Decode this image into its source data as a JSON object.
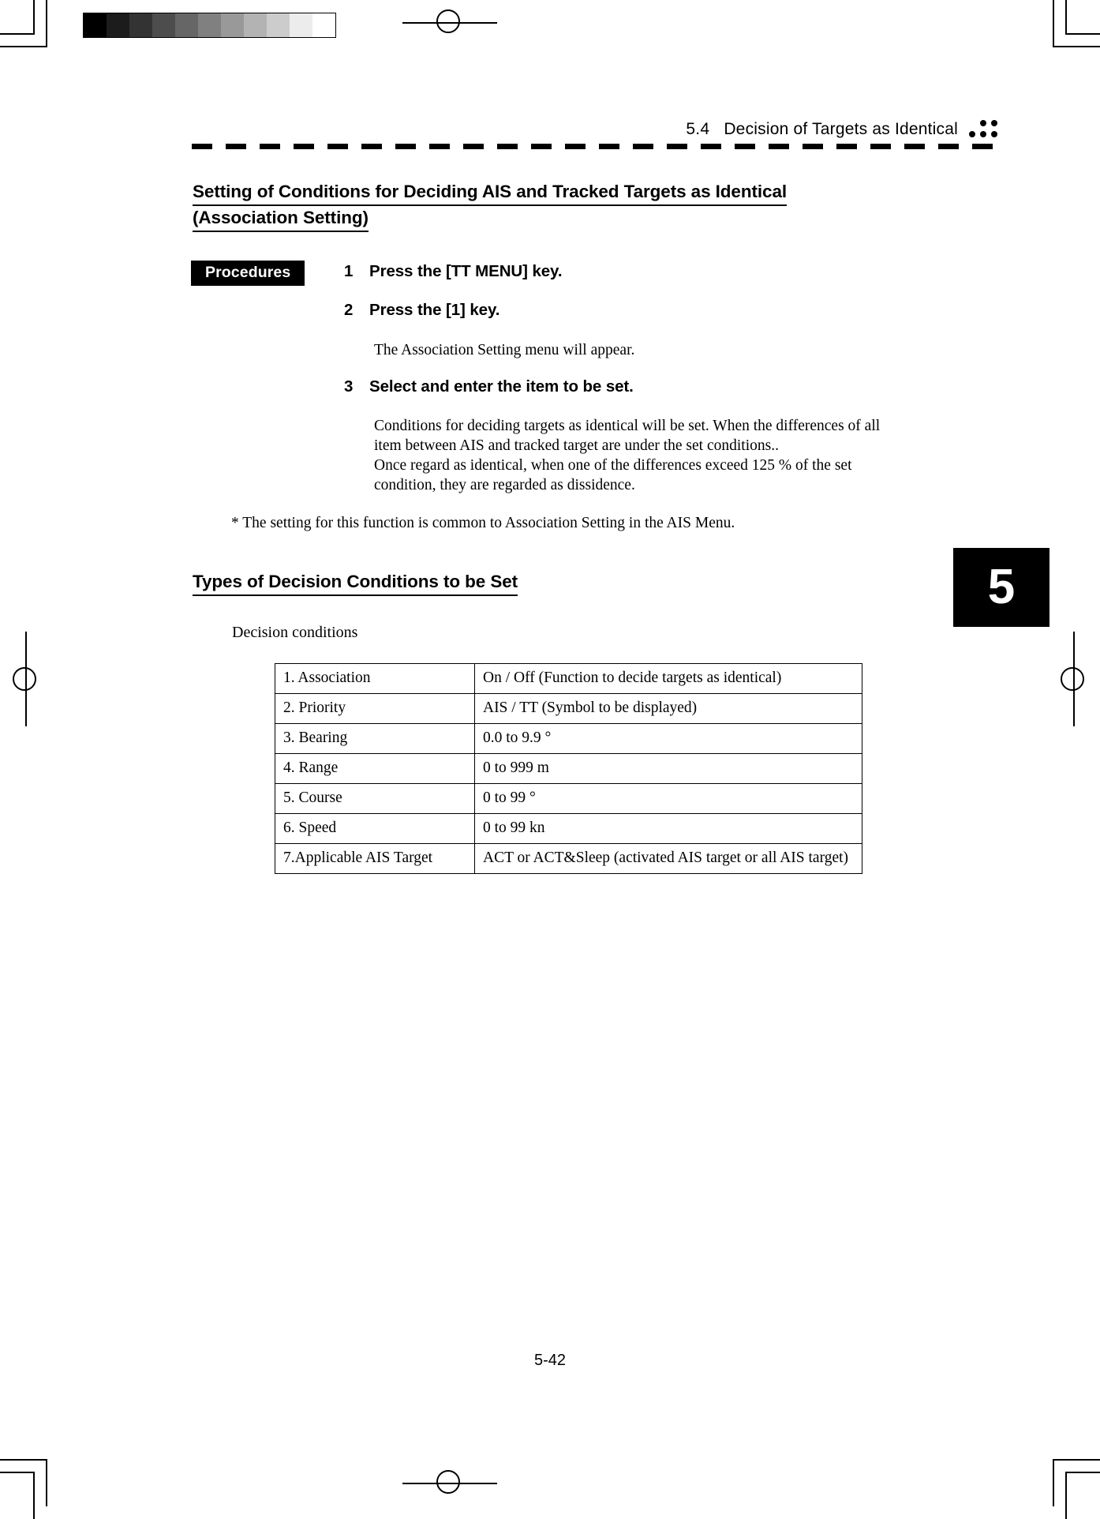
{
  "print_marks": {
    "grayscale_wedge": {
      "name": "grayscale-calibration-wedge",
      "steps": [
        "#000000",
        "#1c1c1c",
        "#333333",
        "#4d4d4d",
        "#666666",
        "#808080",
        "#999999",
        "#b3b3b3",
        "#cccccc",
        "#ececec",
        "#ffffff"
      ]
    },
    "registration_dots": [
      "dot",
      "dot",
      "dot",
      "dot",
      "dot"
    ]
  },
  "running_header": {
    "section_number": "5.4",
    "section_title": "Decision of Targets as Identical",
    "text": "5.4   Decision of Targets as Identical"
  },
  "chapter_tab": {
    "number": "5"
  },
  "headings": {
    "main_line1": "Setting of Conditions for Deciding AIS and Tracked Targets as Identical ",
    "main_line2": "(Association Setting)",
    "types": "Types of Decision Conditions to be Set"
  },
  "procedures": {
    "badge_label": "Procedures",
    "steps": [
      {
        "number": "1",
        "text": "Press the [TT MENU] key."
      },
      {
        "number": "2",
        "text": "Press the [1] key."
      },
      {
        "number": "3",
        "text": "Select and enter the item to be set."
      }
    ],
    "note_after_step2": "The Association Setting menu will appear.",
    "note_after_step3": "Conditions for deciding targets as identical will be set.    When the differences of all item between AIS and tracked target are under the set conditions.. Once regard as identical, when one of the differences exceed 125 % of the set condition, they are regarded as dissidence.",
    "note_after_step3_lines": [
      "Conditions for deciding targets as identical will be set.    When the differences of all",
      "item between AIS and tracked target are under the set conditions..",
      "Once regard as identical, when one of the differences exceed 125 % of the set",
      "condition, they are regarded as dissidence."
    ],
    "footnote": "* The setting for this function is common to Association Setting in the AIS Menu."
  },
  "table_section": {
    "caption": "Decision conditions",
    "rows": [
      {
        "item": "1. Association",
        "value": "On / Off (Function to decide targets as identical)"
      },
      {
        "item": "2. Priority",
        "value": "AIS / TT (Symbol to be displayed)"
      },
      {
        "item": "3. Bearing",
        "value": "0.0 to 9.9 °"
      },
      {
        "item": "4. Range",
        "value": "0 to 999 m"
      },
      {
        "item": "5. Course",
        "value": "0 to 99 °"
      },
      {
        "item": "6. Speed",
        "value": "0 to 99 kn"
      },
      {
        "item": "7.Applicable AIS Target",
        "value": "ACT or ACT&Sleep (activated AIS target or all AIS target)"
      }
    ]
  },
  "footer": {
    "page_number": "5-42"
  }
}
